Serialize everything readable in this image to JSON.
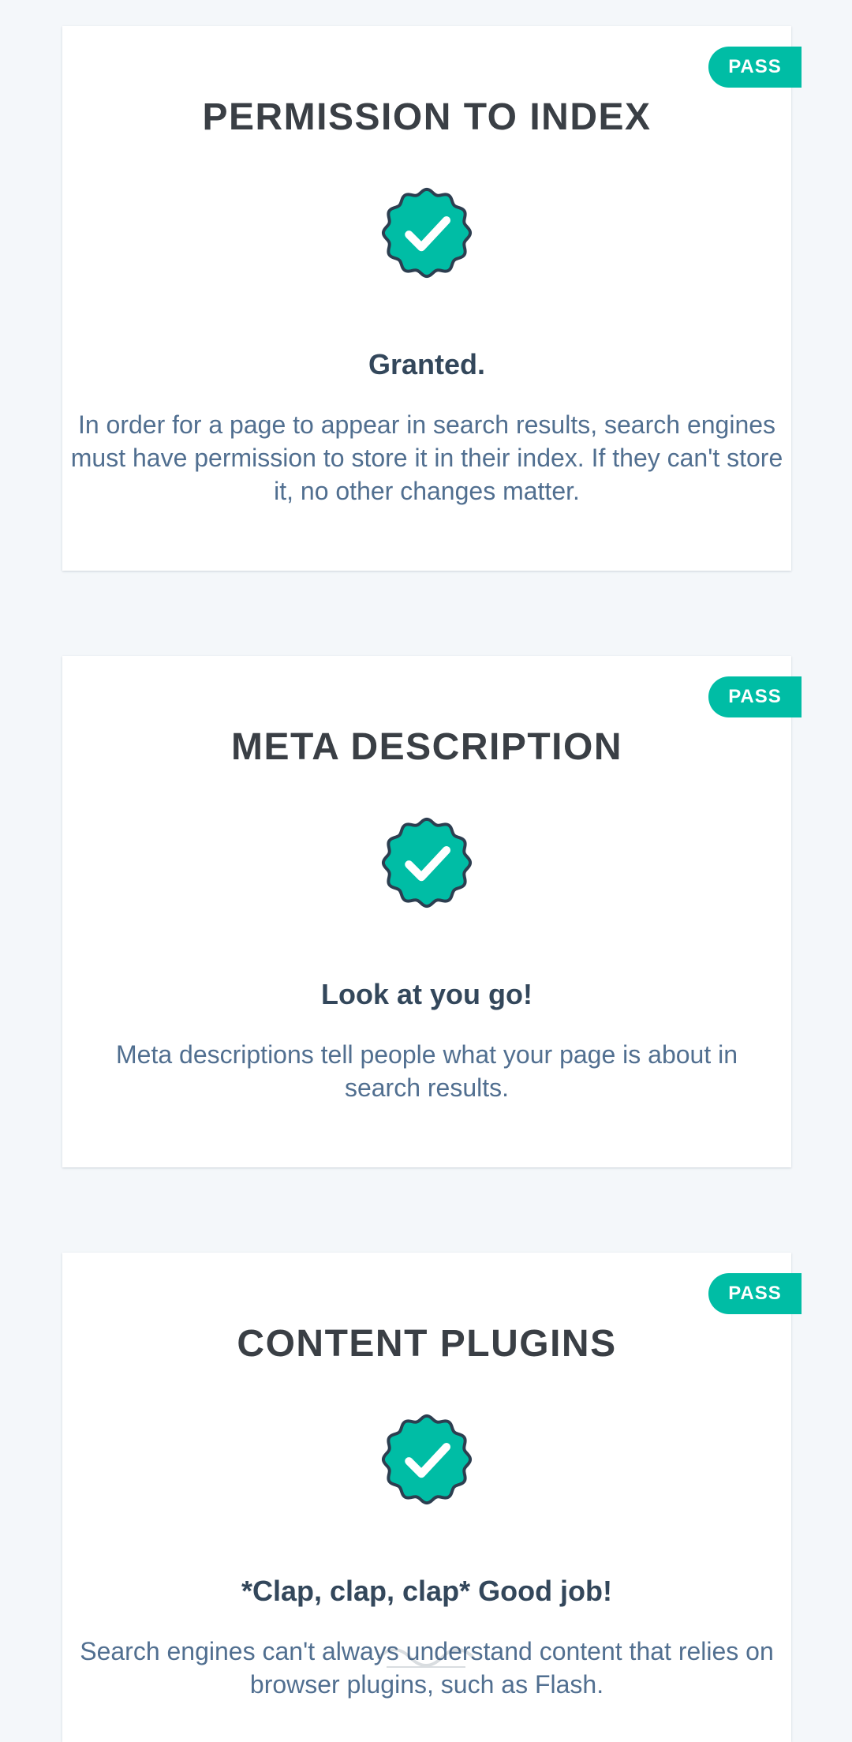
{
  "colors": {
    "page_background": "#f4f7fa",
    "card_background": "#ffffff",
    "pass_badge": "#00bda5",
    "check_fill": "#00bda5",
    "check_outline": "#2d3e50",
    "title_text": "#3a3f45",
    "status_text": "#33475b",
    "description_text": "#516f90"
  },
  "cards": [
    {
      "badge": "PASS",
      "title": "PERMISSION TO INDEX",
      "icon": "check-badge-icon",
      "status": "Granted.",
      "description": "In order for a page to appear in search results, search engines must have permission to store it in their index. If they can't store it, no other changes matter."
    },
    {
      "badge": "PASS",
      "title": "META DESCRIPTION",
      "icon": "check-badge-icon",
      "status": "Look at you go!",
      "description": "Meta descriptions tell people what your page is about in search results."
    },
    {
      "badge": "PASS",
      "title": "CONTENT PLUGINS",
      "icon": "check-badge-icon",
      "status": "*Clap, clap, clap* Good job!",
      "description": "Search engines can't always understand content that relies on browser plugins, such as Flash."
    }
  ]
}
